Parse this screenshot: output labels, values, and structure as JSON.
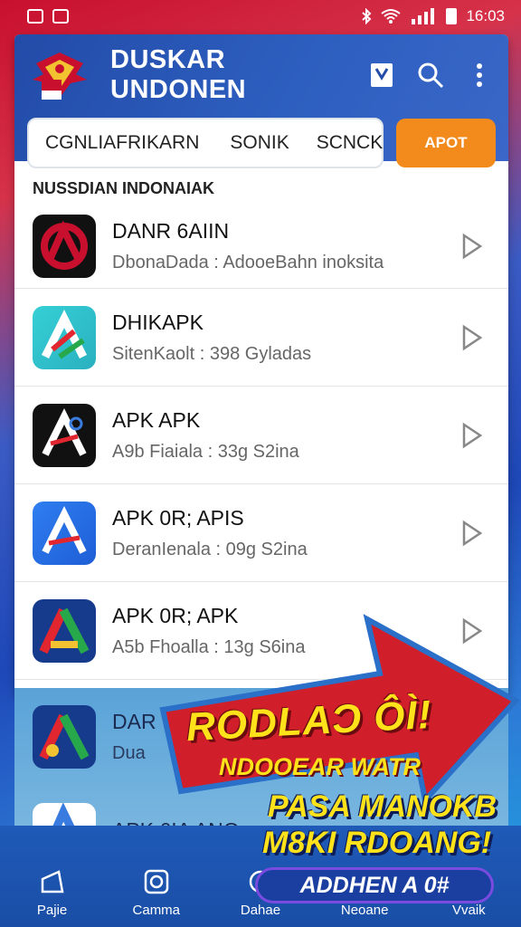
{
  "status": {
    "time": "16:03"
  },
  "header": {
    "title": "DUSKAR UNDONEN",
    "search_tokens": [
      "CGNLIAFRIKARN",
      "SOΝIK",
      "SCNCK"
    ],
    "search_button": "ΑΡΟΤ"
  },
  "section": {
    "title": "NUSSDIAN INDONAIAK"
  },
  "apps": [
    {
      "name": "DANR 6AIIN",
      "desc": "DbonaDada : AdooeBahn inoksita"
    },
    {
      "name": "DHIKAPK",
      "desc": "SitenKaolt : 398 Gyladas"
    },
    {
      "name": "APK APK",
      "desc": "A9b Fiaiala : 33g S2ina"
    },
    {
      "name": "APK 0R; APIS",
      "desc": "DeranIenala : 09g S2ina"
    },
    {
      "name": "APK 0R; APK",
      "desc": "A5b Fhoalla : 13g S6ina"
    }
  ],
  "lower_apps": [
    {
      "name": "DAR",
      "desc": "Dua"
    },
    {
      "name": "APK 6IA ANG",
      "desc": ""
    }
  ],
  "nav": [
    "Pajie",
    "Camma",
    "Dahae",
    "Neoane",
    "Vvaik"
  ],
  "promo": {
    "title": "RODLAƆ ÔÌ!",
    "subtitle": "NDOOEAR WATR",
    "line1": "PASA MANOKB",
    "line2": "M8KI RDOANG!",
    "cta": "ADDHEN A 0#"
  },
  "colors": {
    "header_blue": "#2d5fc0",
    "accent_orange": "#f28a1c",
    "promo_red": "#d01e2a",
    "promo_yellow": "#ffe21a"
  }
}
